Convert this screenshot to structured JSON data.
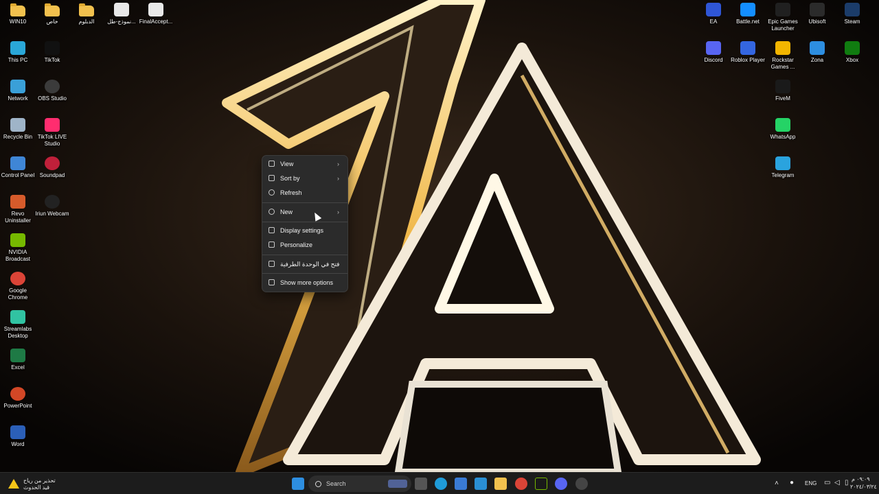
{
  "desktop_left": [
    {
      "label": "WIN10",
      "icon": "folder-icon",
      "kind": "folder"
    },
    {
      "label": "خاص",
      "icon": "folder-icon",
      "kind": "folder"
    },
    {
      "label": "الدبلوم",
      "icon": "folder-icon",
      "kind": "folder"
    },
    {
      "label": "نموذج-طل...",
      "icon": "chrome-doc-icon",
      "kind": "app",
      "color": "#e8e8e8"
    },
    {
      "label": "FinalAccept...",
      "icon": "chrome-doc-icon",
      "kind": "app",
      "color": "#e8e8e8"
    },
    {
      "label": "This PC",
      "icon": "monitor-icon",
      "kind": "app",
      "color": "#2aa7d8"
    },
    {
      "label": "TikTok",
      "icon": "tiktok-icon",
      "kind": "app",
      "color": "#111111"
    },
    {
      "label": "Network",
      "icon": "network-icon",
      "kind": "app",
      "color": "#3aa0d8"
    },
    {
      "label": "OBS Studio",
      "icon": "obs-icon",
      "kind": "round",
      "color": "#3b3b3b"
    },
    {
      "label": "Recycle Bin",
      "icon": "recycle-bin-icon",
      "kind": "app",
      "color": "#9fb4c8"
    },
    {
      "label": "TikTok LIVE Studio",
      "icon": "tiktok-live-icon",
      "kind": "app",
      "color": "#ff2d6f"
    },
    {
      "label": "Control Panel",
      "icon": "control-panel-icon",
      "kind": "app",
      "color": "#3f86d6"
    },
    {
      "label": "Soundpad",
      "icon": "soundpad-icon",
      "kind": "round",
      "color": "#c0203a"
    },
    {
      "label": "Revo Uninstaller",
      "icon": "revo-icon",
      "kind": "app",
      "color": "#d65b2b"
    },
    {
      "label": "Iriun Webcam",
      "icon": "webcam-icon",
      "kind": "round",
      "color": "#222222"
    },
    {
      "label": "NVIDIA Broadcast",
      "icon": "nvidia-icon",
      "kind": "app",
      "color": "#76b900"
    },
    {
      "label": "Google Chrome",
      "icon": "chrome-icon",
      "kind": "round",
      "color": "#db4437"
    },
    {
      "label": "Streamlabs Desktop",
      "icon": "streamlabs-icon",
      "kind": "app",
      "color": "#31c3a2"
    },
    {
      "label": "Excel",
      "icon": "excel-icon",
      "kind": "app",
      "color": "#1e7a45"
    },
    {
      "label": "PowerPoint",
      "icon": "powerpoint-icon",
      "kind": "round",
      "color": "#d24726"
    },
    {
      "label": "Word",
      "icon": "word-icon",
      "kind": "app",
      "color": "#2b5fb8"
    }
  ],
  "desktop_right": [
    {
      "label": "EA",
      "icon": "ea-icon",
      "color": "#2f56d6"
    },
    {
      "label": "Battle.net",
      "icon": "battlenet-icon",
      "color": "#148eff"
    },
    {
      "label": "Epic Games Launcher",
      "icon": "epic-games-icon",
      "color": "#202020"
    },
    {
      "label": "Ubisoft",
      "icon": "ubisoft-icon",
      "color": "#2b2b2b"
    },
    {
      "label": "Steam",
      "icon": "steam-icon",
      "color": "#1b3c6a"
    },
    {
      "label": "Discord",
      "icon": "discord-icon",
      "color": "#5865f2"
    },
    {
      "label": "Roblox Player",
      "icon": "roblox-icon",
      "color": "#3466e0"
    },
    {
      "label": "Rockstar Games ...",
      "icon": "rockstar-icon",
      "color": "#f2b500"
    },
    {
      "label": "Zona",
      "icon": "zona-icon",
      "color": "#2d8ee0"
    },
    {
      "label": "Xbox",
      "icon": "xbox-icon",
      "color": "#107c10"
    },
    {
      "label": "FiveM",
      "icon": "fivem-icon",
      "color": "#1a1a1a"
    },
    {
      "label": "WhatsApp",
      "icon": "whatsapp-icon",
      "color": "#25d366"
    },
    {
      "label": "Telegram",
      "icon": "telegram-icon",
      "color": "#2aa3de"
    }
  ],
  "context_menu": {
    "items": [
      {
        "label": "View",
        "icon": "view-grid-icon",
        "submenu": true
      },
      {
        "label": "Sort by",
        "icon": "sort-icon",
        "submenu": true
      },
      {
        "label": "Refresh",
        "icon": "refresh-icon",
        "submenu": false
      },
      {
        "label": "New",
        "icon": "new-plus-icon",
        "submenu": true
      },
      {
        "label": "Display settings",
        "icon": "display-settings-icon",
        "submenu": false
      },
      {
        "label": "Personalize",
        "icon": "personalize-pen-icon",
        "submenu": false
      },
      {
        "label": "فتح في الوحدة الطرفية",
        "icon": "terminal-icon",
        "submenu": false
      },
      {
        "label": "Show more options",
        "icon": "more-options-icon",
        "submenu": false
      }
    ],
    "arrow": "›"
  },
  "taskbar": {
    "weather_title": "تحذير من رياح",
    "weather_sub": "قيد الحدوث",
    "search_placeholder": "Search",
    "language": "ENG",
    "time": "٠٩:٠٩ م",
    "date": "٢٠٢٤/٠٣/٢٤"
  }
}
